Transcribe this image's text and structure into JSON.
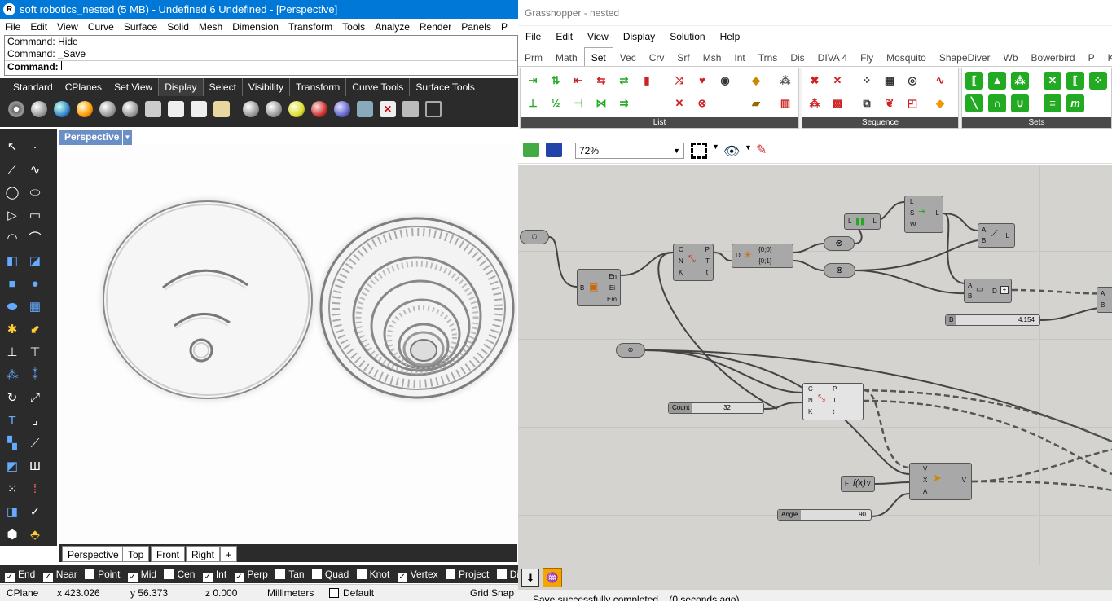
{
  "rhino": {
    "title": "soft robotics_nested (5 MB) - Undefined 6 Undefined - [Perspective]",
    "menu": [
      "File",
      "Edit",
      "View",
      "Curve",
      "Surface",
      "Solid",
      "Mesh",
      "Dimension",
      "Transform",
      "Tools",
      "Analyze",
      "Render",
      "Panels",
      "P"
    ],
    "command_history": [
      "Command: Hide",
      "Command: _Save"
    ],
    "command_prompt": "Command:",
    "toolbar_tabs": [
      "Standard",
      "CPlanes",
      "Set View",
      "Display",
      "Select",
      "Visibility",
      "Transform",
      "Curve Tools",
      "Surface Tools"
    ],
    "active_tab": "Display",
    "viewport_title": "Perspective",
    "viewport_tabs": [
      "Perspective",
      "Top",
      "Front",
      "Right",
      "+"
    ],
    "osnaps": [
      {
        "label": "End",
        "checked": true
      },
      {
        "label": "Near",
        "checked": true
      },
      {
        "label": "Point",
        "checked": false
      },
      {
        "label": "Mid",
        "checked": true
      },
      {
        "label": "Cen",
        "checked": false
      },
      {
        "label": "Int",
        "checked": true
      },
      {
        "label": "Perp",
        "checked": true
      },
      {
        "label": "Tan",
        "checked": false
      },
      {
        "label": "Quad",
        "checked": false
      },
      {
        "label": "Knot",
        "checked": false
      },
      {
        "label": "Vertex",
        "checked": true
      },
      {
        "label": "Project",
        "checked": false
      },
      {
        "label": "Disab",
        "checked": false
      }
    ],
    "status": {
      "cplane": "CPlane",
      "x": "x 423.026",
      "y": "y 56.373",
      "z": "z 0.000",
      "units": "Millimeters",
      "layer": "Default",
      "grid_snap": "Grid Snap"
    }
  },
  "gh": {
    "title": "Grasshopper - nested",
    "menu": [
      "File",
      "Edit",
      "View",
      "Display",
      "Solution",
      "Help"
    ],
    "tabs": [
      "Prm",
      "Math",
      "Set",
      "Vec",
      "Crv",
      "Srf",
      "Msh",
      "Int",
      "Trns",
      "Dis",
      "DIVA 4",
      "Fly",
      "Mosquito",
      "ShapeDiver",
      "Wb",
      "Bowerbird",
      "P",
      "K"
    ],
    "active_tab": "Set",
    "ribbon_sections": [
      "List",
      "Sequence",
      "Sets"
    ],
    "zoom": "72%",
    "components": {
      "ee": {
        "inputs": [
          "B"
        ],
        "outputs": [
          "En",
          "Ei",
          "Em"
        ]
      },
      "div1": {
        "inputs": [
          "C",
          "N",
          "K"
        ],
        "outputs": [
          "P",
          "T",
          "t"
        ]
      },
      "tree": {
        "inputs": [
          "D"
        ],
        "outputs": [
          "{0;0}",
          "{0;1}"
        ]
      },
      "merge": {
        "inputs": [
          "L",
          "S",
          "W"
        ],
        "outputs": [
          "L"
        ]
      },
      "line": {
        "inputs": [
          "A",
          "B"
        ],
        "outputs": [
          "L"
        ]
      },
      "len": {
        "inputs": [
          "L"
        ],
        "outputs": [
          "L"
        ]
      },
      "dist": {
        "inputs": [
          "A",
          "B"
        ],
        "outputs": [
          "D"
        ]
      },
      "div2": {
        "inputs": [
          "C",
          "N",
          "K"
        ],
        "outputs": [
          "P",
          "T",
          "t"
        ]
      },
      "expr": {
        "inputs": [
          "F"
        ],
        "outputs": [
          "V"
        ]
      },
      "rot": {
        "inputs": [
          "V",
          "X",
          "A"
        ],
        "outputs": [
          "V"
        ]
      },
      "edge": {
        "inputs": [
          "A",
          "B"
        ],
        "outputs": []
      }
    },
    "sliders": [
      {
        "name": "B",
        "value": "4.154"
      },
      {
        "name": "Count",
        "value": "32"
      },
      {
        "name": "Angle",
        "value": "90"
      }
    ],
    "status": "Save successfully completed... (0 seconds ago)"
  }
}
